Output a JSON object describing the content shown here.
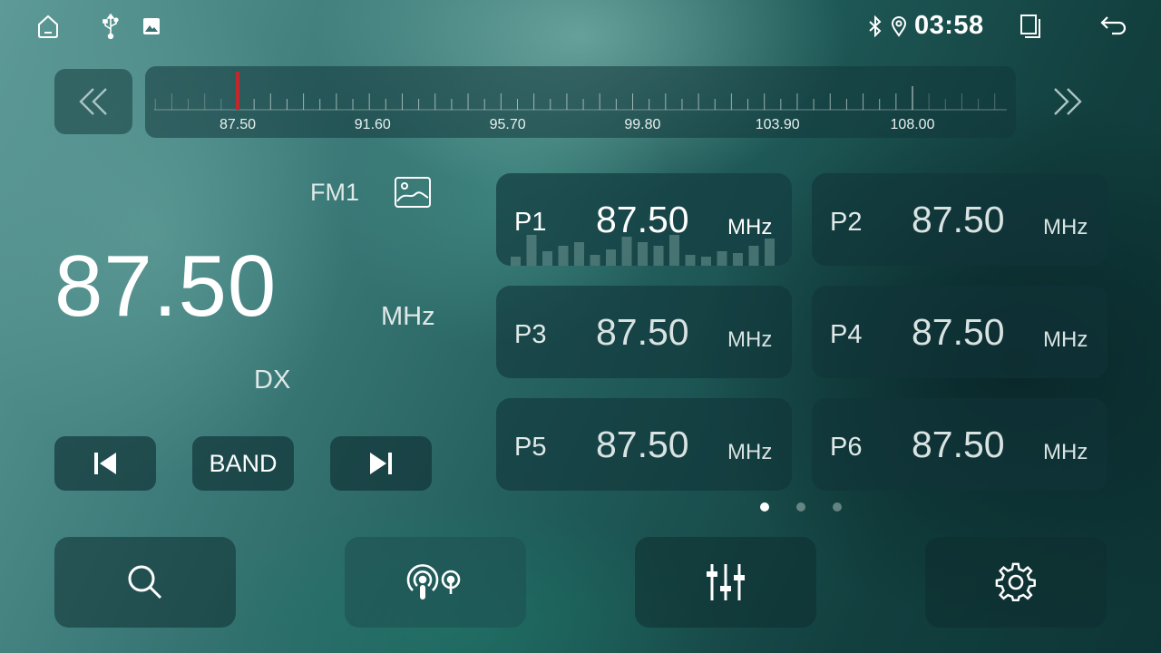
{
  "status_bar": {
    "icons": [
      "home-icon",
      "usb-icon",
      "gallery-icon",
      "bluetooth-icon",
      "location-icon",
      "multitask-icon",
      "back-icon"
    ],
    "time": "03:58"
  },
  "tuner": {
    "prev_icon": "double-chevron-left-icon",
    "next_icon": "double-chevron-right-icon",
    "scale_labels": [
      "87.50",
      "91.60",
      "95.70",
      "99.80",
      "103.90",
      "108.00"
    ],
    "scale_min": 87.5,
    "scale_max": 108.0,
    "current_position": 87.5,
    "indicator_color": "#c0282d"
  },
  "main": {
    "band": "FM1",
    "frequency": "87.50",
    "unit": "MHz",
    "dx": "DX",
    "controls": {
      "prev_icon": "skip-previous-icon",
      "band_label": "BAND",
      "next_icon": "skip-next-icon"
    }
  },
  "presets": [
    {
      "name": "P1",
      "freq": "87.50",
      "unit": "MHz",
      "active": true
    },
    {
      "name": "P2",
      "freq": "87.50",
      "unit": "MHz",
      "active": false
    },
    {
      "name": "P3",
      "freq": "87.50",
      "unit": "MHz",
      "active": false
    },
    {
      "name": "P4",
      "freq": "87.50",
      "unit": "MHz",
      "active": false
    },
    {
      "name": "P5",
      "freq": "87.50",
      "unit": "MHz",
      "active": false
    },
    {
      "name": "P6",
      "freq": "87.50",
      "unit": "MHz",
      "active": false
    }
  ],
  "page_indicator": {
    "pages": 3,
    "current": 1
  },
  "bottom_bar": [
    "search-icon",
    "radio-broadcast-icon",
    "equalizer-icon",
    "settings-icon"
  ],
  "colors": {
    "accent": "#ffffff",
    "needle": "#c0282d"
  }
}
